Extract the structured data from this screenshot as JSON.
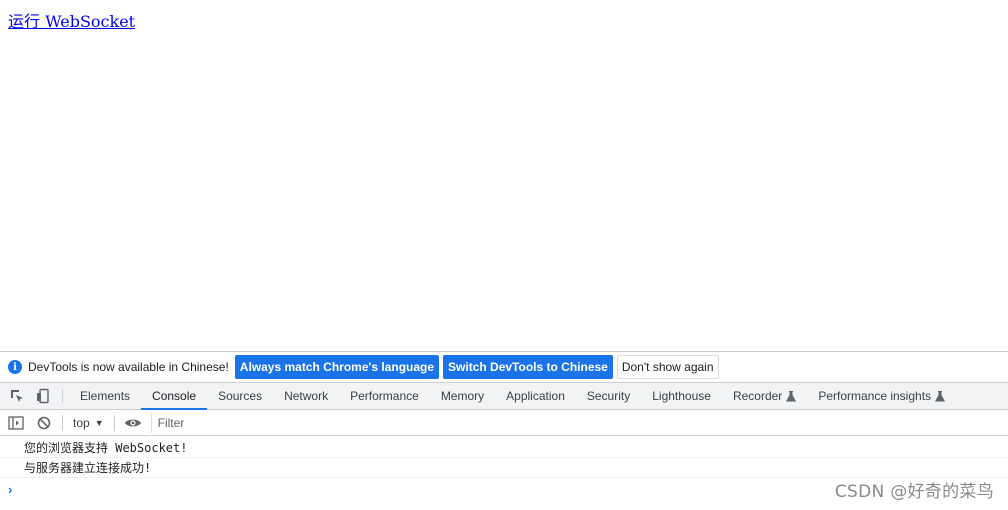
{
  "page": {
    "link_text": "运行 WebSocket"
  },
  "infobar": {
    "message": "DevTools is now available in Chinese!",
    "btn_match": "Always match Chrome's language",
    "btn_switch": "Switch DevTools to Chinese",
    "btn_dismiss": "Don't show again",
    "info_icon_glyph": "i"
  },
  "tabs": [
    {
      "label": "Elements"
    },
    {
      "label": "Console"
    },
    {
      "label": "Sources"
    },
    {
      "label": "Network"
    },
    {
      "label": "Performance"
    },
    {
      "label": "Memory"
    },
    {
      "label": "Application"
    },
    {
      "label": "Security"
    },
    {
      "label": "Lighthouse"
    },
    {
      "label": "Recorder"
    },
    {
      "label": "Performance insights"
    }
  ],
  "active_tab": "Console",
  "console_toolbar": {
    "context": "top",
    "filter_placeholder": "Filter"
  },
  "console_messages": [
    {
      "text": "您的浏览器支持 WebSocket!"
    },
    {
      "text": "与服务器建立连接成功!"
    }
  ],
  "prompt_glyph": "›",
  "watermark": "CSDN @好奇的菜鸟",
  "colors": {
    "accent": "#1a73e8",
    "link": "#0000ee"
  }
}
